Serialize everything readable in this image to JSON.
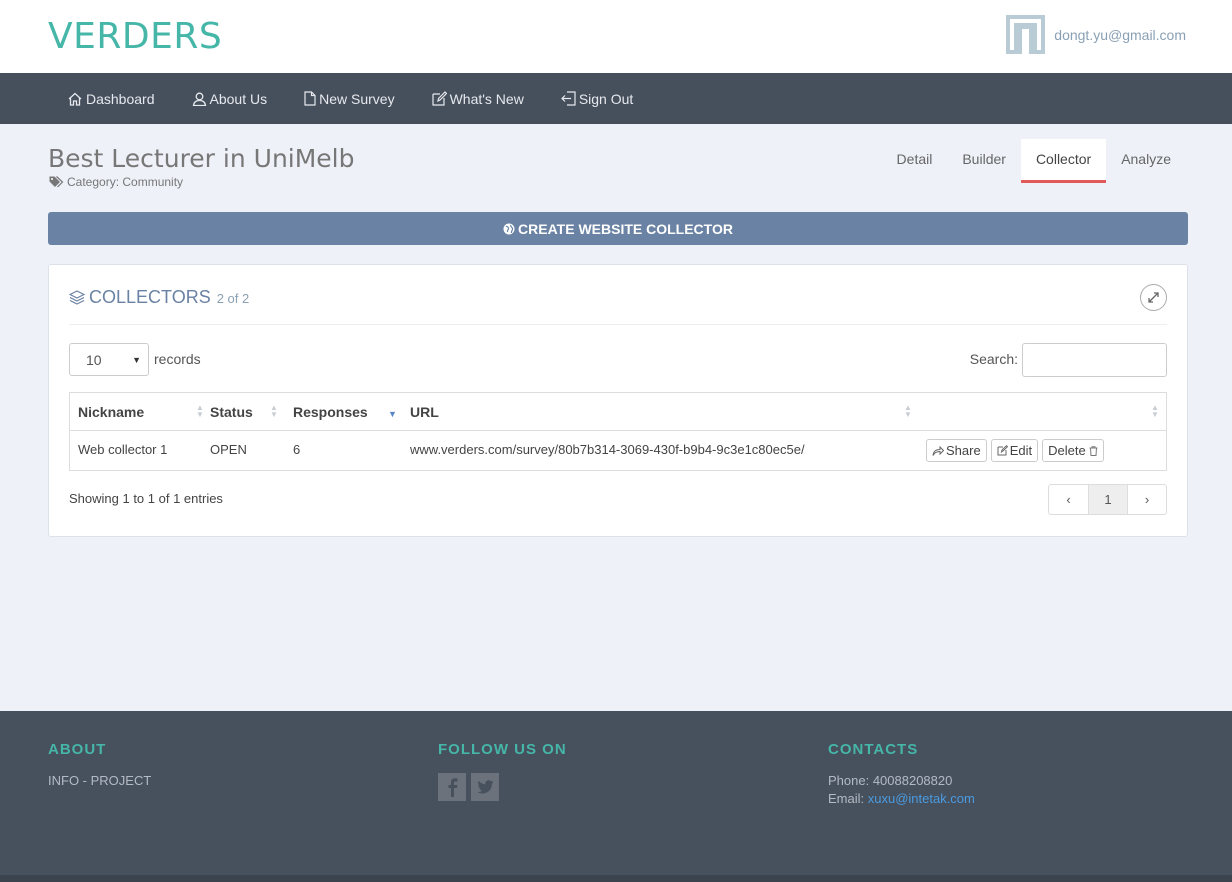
{
  "header": {
    "brand": "VERDERS",
    "user_email": "dongt.yu@gmail.com"
  },
  "nav": {
    "items": [
      {
        "label": "Dashboard",
        "icon": "home-icon"
      },
      {
        "label": "About Us",
        "icon": "user-icon"
      },
      {
        "label": "New Survey",
        "icon": "file-icon"
      },
      {
        "label": "What's New",
        "icon": "edit-icon"
      },
      {
        "label": "Sign Out",
        "icon": "sign-out-icon"
      }
    ]
  },
  "survey": {
    "title": "Best Lecturer in UniMelb",
    "category": "Category: Community"
  },
  "tabs": [
    {
      "label": "Detail"
    },
    {
      "label": "Builder"
    },
    {
      "label": "Collector",
      "active": true
    },
    {
      "label": "Analyze"
    }
  ],
  "create_button": "CREATE WEBSITE COLLECTOR",
  "panel": {
    "title": "COLLECTORS",
    "count": "2 of 2",
    "length_value": "10",
    "records_label": "records",
    "search_label": "Search:",
    "columns": [
      "Nickname",
      "Status",
      "Responses",
      "URL"
    ],
    "rows": [
      {
        "nickname": "Web collector 1",
        "status": "OPEN",
        "responses": "6",
        "url": "www.verders.com/survey/80b7b314-3069-430f-b9b4-9c3e1c80ec5e/",
        "share": "Share",
        "edit": "Edit",
        "delete": "Delete"
      }
    ],
    "info": "Showing 1 to 1 of 1 entries",
    "pager": {
      "prev": "‹",
      "page": "1",
      "next": "›"
    }
  },
  "footer": {
    "about_heading": "ABOUT",
    "about_text": "INFO - PROJECT",
    "follow_heading": "FOLLOW US ON",
    "contacts_heading": "CONTACTS",
    "phone": "Phone: 40088208820",
    "email_label": "Email: ",
    "email": "xuxu@intetak.com"
  },
  "colors": {
    "brand": "#45b6a8",
    "nav_bg": "#464f5c",
    "button_bg": "#6a82a3",
    "active_tab": "#e05a5a",
    "footer_bg": "#47505d"
  }
}
